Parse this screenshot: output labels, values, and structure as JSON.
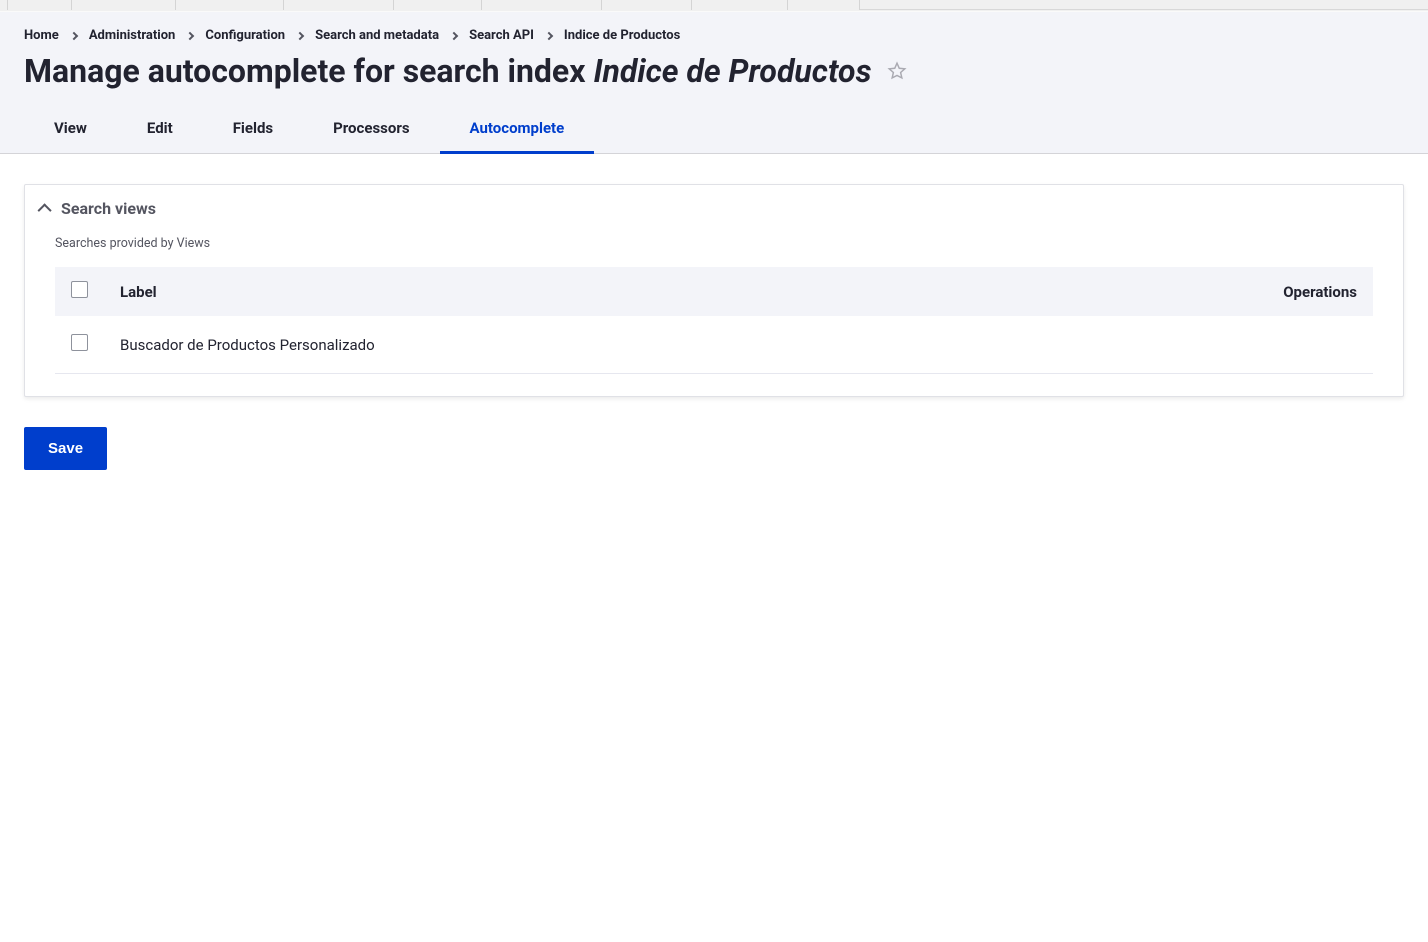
{
  "breadcrumb": {
    "items": [
      {
        "label": "Home"
      },
      {
        "label": "Administration"
      },
      {
        "label": "Configuration"
      },
      {
        "label": "Search and metadata"
      },
      {
        "label": "Search API"
      },
      {
        "label": "Indice de Productos"
      }
    ]
  },
  "page_title": {
    "prefix": "Manage autocomplete for search index ",
    "index_name": "Indice de Productos"
  },
  "tabs": {
    "items": [
      {
        "label": "View",
        "active": false
      },
      {
        "label": "Edit",
        "active": false
      },
      {
        "label": "Fields",
        "active": false
      },
      {
        "label": "Processors",
        "active": false
      },
      {
        "label": "Autocomplete",
        "active": true
      }
    ]
  },
  "details": {
    "title": "Search views",
    "description": "Searches provided by Views",
    "table": {
      "headers": {
        "label": "Label",
        "operations": "Operations"
      },
      "rows": [
        {
          "label": "Buscador de Productos Personalizado",
          "checked": false
        }
      ]
    }
  },
  "actions": {
    "save_label": "Save"
  }
}
